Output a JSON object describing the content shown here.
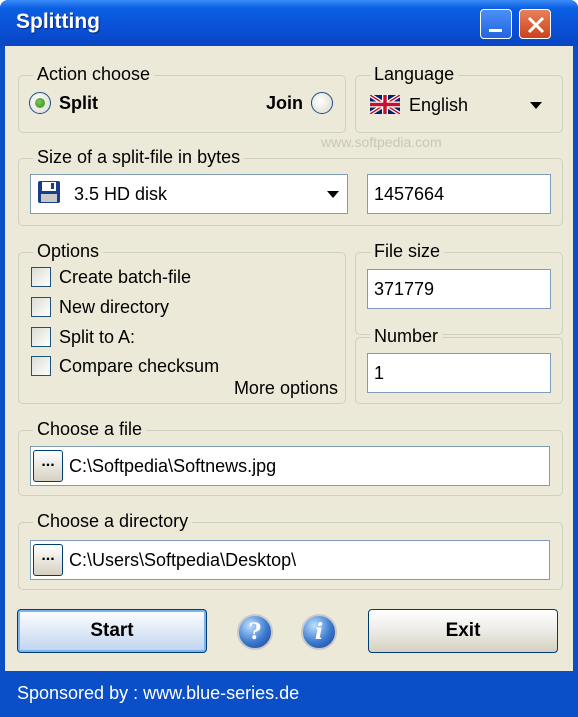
{
  "window": {
    "title": "Splitting"
  },
  "action": {
    "label": "Action choose",
    "split_label": "Split",
    "join_label": "Join",
    "selected": "split"
  },
  "language": {
    "label": "Language",
    "value": "English",
    "icon": "uk-flag-icon"
  },
  "size": {
    "label": "Size of a split-file in bytes",
    "preset_value": "3.5 HD disk",
    "preset_icon": "floppy-disk-icon",
    "bytes_value": "1457664"
  },
  "options": {
    "label": "Options",
    "items": [
      {
        "label": "Create batch-file",
        "checked": false
      },
      {
        "label": "New directory",
        "checked": false
      },
      {
        "label": "Split to A:",
        "checked": false
      },
      {
        "label": "Compare checksum",
        "checked": false
      }
    ],
    "more_label": "More options"
  },
  "file_size": {
    "label": "File size",
    "value": "371779"
  },
  "number": {
    "label": "Number",
    "value": "1"
  },
  "choose_file": {
    "label": "Choose a file",
    "browse_label": "...",
    "value": "C:\\Softpedia\\Softnews.jpg"
  },
  "choose_dir": {
    "label": "Choose a directory",
    "browse_label": "...",
    "value": "C:\\Users\\Softpedia\\Desktop\\"
  },
  "buttons": {
    "start": "Start",
    "exit": "Exit",
    "help_glyph": "?",
    "info_glyph": "i"
  },
  "footer": {
    "text": "Sponsored by : www.blue-series.de"
  },
  "watermark": {
    "text": "www.softpedia.com"
  },
  "colors": {
    "titlebar": "#0a50d6",
    "client_bg": "#ece9d8",
    "radio_selected": "#2b8a14",
    "close_button": "#c8421c"
  }
}
